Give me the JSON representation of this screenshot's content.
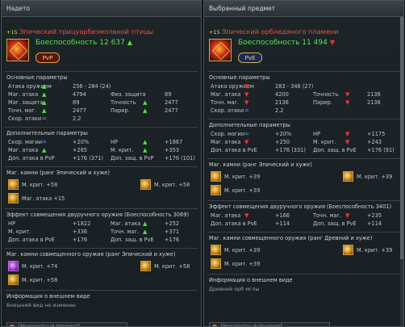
{
  "left": {
    "header": "Надето",
    "title_plus": "+15",
    "title": "Эпический трицуарбезмолвной птицы",
    "gs_label": "Боеспособность 12 637",
    "gs_arrow": "▲",
    "mode": "PvP",
    "basic": {
      "title": "Основные параметры",
      "rows": [
        {
          "a": "Атака оружием",
          "ai": "up",
          "av": "256 - 284 (24)",
          "b": "",
          "bi": "",
          "bv": ""
        },
        {
          "a": "Маг. атака",
          "ai": "up",
          "av": "4794",
          "b": "Физ. защита",
          "bi": "",
          "bv": "89"
        },
        {
          "a": "Маг. защита",
          "ai": "up",
          "av": "89",
          "b": "Точность",
          "bi": "up",
          "bv": "2477"
        },
        {
          "a": "Точн. маг.",
          "ai": "up",
          "av": "2477",
          "b": "Париp.",
          "bi": "up",
          "bv": "2477"
        },
        {
          "a": "Скор. атаки",
          "ai": "eq",
          "av": "2.2",
          "b": "",
          "bi": "",
          "bv": ""
        }
      ]
    },
    "extra": {
      "title": "Дополнительные параметры",
      "rows": [
        {
          "a": "Скор. магии",
          "ai": "eq",
          "av": "+20%",
          "b": "HP",
          "bi": "up",
          "bv": "+1867"
        },
        {
          "a": "Маг. атака",
          "ai": "up",
          "av": "+265",
          "b": "М. крит.",
          "bi": "up",
          "bv": "+353"
        },
        {
          "a": "Доп. атака в PvP",
          "ai": "",
          "av": "+176 (371)",
          "b": "Доп. защ. в PvP",
          "bi": "",
          "bv": "+176 (101)"
        }
      ]
    },
    "gems": {
      "title": "Маг. камни (ранг Эпический и хуже)",
      "items": [
        {
          "label": "М. крит. +58"
        },
        {
          "label": "М. крит. +58"
        },
        {
          "label": "Маг. атака +15"
        }
      ]
    },
    "twohand": {
      "title": "Эффект совмещения двуручного оружия (Боеспособность 3069)",
      "rows": [
        {
          "a": "HP",
          "ai": "",
          "av": "+1822",
          "b": "Маг. атака",
          "bi": "up",
          "bv": "+252"
        },
        {
          "a": "М. крит.",
          "ai": "",
          "av": "+336",
          "b": "Точн. маг.",
          "bi": "up",
          "bv": "+371"
        },
        {
          "a": "Доп. атака в PvE",
          "ai": "",
          "av": "+176",
          "b": "Доп. защ. в PvE",
          "bi": "",
          "bv": "+176"
        }
      ]
    },
    "gems2": {
      "title": "Маг. камни совмещенного оружия (ранг Эпический и хуже)",
      "items": [
        {
          "label": "М. крит. +74"
        },
        {
          "label": "М. крит. +58"
        },
        {
          "label": "М. крит. +58"
        }
      ]
    },
    "appearance": {
      "title": "Информация о внешнем виде",
      "sub": "Внешний вид не изменен"
    },
    "bottom_btn": "[Неизвестный предмет]"
  },
  "right": {
    "header": "Выбранный предмет",
    "title_plus": "+15",
    "title": "Эпический орбледяного пламени",
    "gs_label": "Боеспособность 11 494",
    "gs_arrow": "▼",
    "mode": "PvE",
    "basic": {
      "title": "Основные параметры",
      "rows": [
        {
          "a": "Атака оружием",
          "ai": "down",
          "av": "283 - 346 (27)",
          "b": "",
          "bi": "",
          "bv": ""
        },
        {
          "a": "Маг. атака",
          "ai": "down",
          "av": "4200",
          "b": "Точность",
          "bi": "down",
          "bv": "2136"
        },
        {
          "a": "Точн. маг.",
          "ai": "down",
          "av": "2136",
          "b": "Париp.",
          "bi": "down",
          "bv": "2136"
        },
        {
          "a": "Скор. атаки",
          "ai": "eq",
          "av": "2.2",
          "b": "",
          "bi": "",
          "bv": ""
        }
      ]
    },
    "extra": {
      "title": "Дополнительные параметры",
      "rows": [
        {
          "a": "Скор. магии",
          "ai": "eq",
          "av": "+20%",
          "b": "HP",
          "bi": "down",
          "bv": "+1175"
        },
        {
          "a": "Маг. атака",
          "ai": "down",
          "av": "+250",
          "b": "М. крит.",
          "bi": "down",
          "bv": "+243"
        },
        {
          "a": "Доп. атака в PvE",
          "ai": "",
          "av": "+176 (331)",
          "b": "Доп. защ. в PvE",
          "bi": "",
          "bv": "+176 (91)"
        }
      ]
    },
    "gems": {
      "title": "Маг. камни (ранг Эпический и хуже)",
      "items": [
        {
          "label": "М. крит. +39"
        },
        {
          "label": "М. крит. +39"
        },
        {
          "label": "М. крит. +39"
        }
      ]
    },
    "twohand": {
      "title": "Эффект совмещения двуручного оружия (Боеспособность 3401)",
      "rows": [
        {
          "a": "Маг. атака",
          "ai": "down",
          "av": "+166",
          "b": "Точн. маг.",
          "bi": "down",
          "bv": "+235"
        },
        {
          "a": "Доп. атака в PvE",
          "ai": "",
          "av": "+114",
          "b": "Доп. защ. в PvE",
          "bi": "",
          "bv": "+114"
        }
      ]
    },
    "gems2": {
      "title": "Маг. камни совмещенного оружия (ранг Древний и хуже)",
      "items": [
        {
          "label": "М. крит. +39"
        },
        {
          "label": "М. крит. +39"
        },
        {
          "label": "М. крит. +39"
        }
      ]
    },
    "appearance": {
      "title": "Информация о внешнем виде",
      "sub": "Древний орб мглы"
    },
    "bottom_btn": "[Неизвестный предмет]"
  },
  "colors": {
    "up": "#54e34a",
    "down": "#ff3030",
    "eq": "#59a9ff",
    "title_red": "#f0503c",
    "gs_green": "#52e34a"
  },
  "icons": {
    "up": "arrow-up-icon",
    "down": "arrow-down-icon",
    "eq": "equal-icon"
  }
}
